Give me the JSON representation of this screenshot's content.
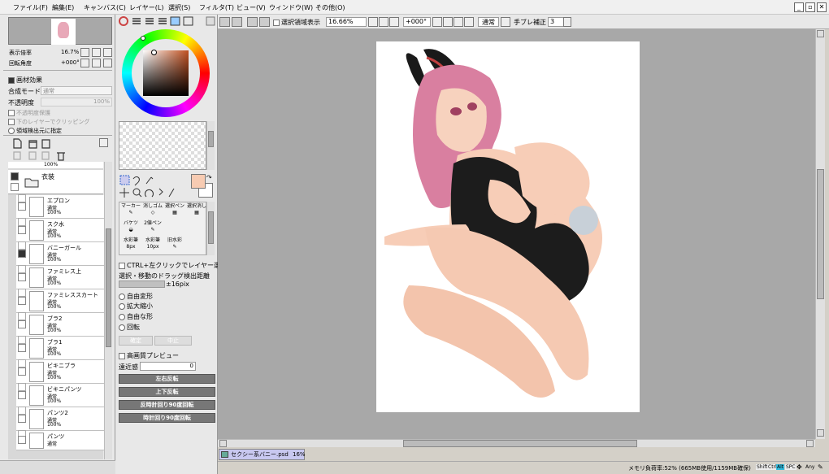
{
  "menu": [
    "ファイル(F)",
    "編集(E)",
    "キャンバス(C)",
    "レイヤー(L)",
    "選択(S)",
    "フィルタ(T)",
    "ビュー(V)",
    "ウィンドウ(W)",
    "その他(O)"
  ],
  "navigator": {
    "zoom_label": "表示倍率",
    "zoom_value": "16.7%",
    "rotate_label": "回転角度",
    "rotate_value": "+000°"
  },
  "material": {
    "title": "画材効果",
    "blend_label": "合成モード",
    "blend_value": "通常",
    "opacity_label": "不透明度",
    "opacity_value": "100%",
    "protect_opacity": "不透明度保護",
    "clip": "下のレイヤーでクリッピング",
    "detect": "領域検出元に指定"
  },
  "layers": [
    {
      "name": "衣装",
      "mode": "",
      "opacity": "",
      "folder": true
    },
    {
      "name": "エプロン",
      "mode": "通常",
      "opacity": "100%"
    },
    {
      "name": "スク水",
      "mode": "通常",
      "opacity": "100%"
    },
    {
      "name": "バニーガール",
      "mode": "通常",
      "opacity": "100%"
    },
    {
      "name": "ファミレス上",
      "mode": "通常",
      "opacity": "100%"
    },
    {
      "name": "ファミレススカート",
      "mode": "通常",
      "opacity": "100%"
    },
    {
      "name": "ブラ2",
      "mode": "通常",
      "opacity": "100%"
    },
    {
      "name": "ブラ1",
      "mode": "通常",
      "opacity": "100%"
    },
    {
      "name": "ビキニブラ",
      "mode": "通常",
      "opacity": "100%"
    },
    {
      "name": "ビキニパンツ",
      "mode": "通常",
      "opacity": "100%"
    },
    {
      "name": "パンツ2",
      "mode": "通常",
      "opacity": "100%"
    },
    {
      "name": "パンツ",
      "mode": "通常",
      "opacity": ""
    }
  ],
  "layer_top_opacity": "100%",
  "brushes": [
    {
      "name": "マーカー"
    },
    {
      "name": "消しゴム"
    },
    {
      "name": "選択ペン"
    },
    {
      "name": "選択消し"
    },
    {
      "name": "バケツ"
    },
    {
      "name": "2値ペン"
    },
    {
      "name": "水彩筆",
      "size": "8px"
    },
    {
      "name": "水彩筆",
      "size": "10px"
    },
    {
      "name": "旧水彩"
    }
  ],
  "options": {
    "ctrl_select": "CTRL+左クリックでレイヤー選択",
    "drag_label": "選択・移動のドラッグ検出距離",
    "drag_value": "±16pix",
    "transforms": [
      "自由変形",
      "拡大縮小",
      "自由な形",
      "回転"
    ],
    "ok": "確定",
    "cancel": "中止",
    "hq_preview": "高画質プレビュー",
    "distance_label": "遠近感",
    "distance_value": "0",
    "actions": [
      "左右反転",
      "上下反転",
      "反時計回り90度回転",
      "時計回り90度回転"
    ]
  },
  "toolbar": {
    "selection_display": "選択領域表示",
    "zoom": "16.66%",
    "angle": "+000°",
    "mode": "通常",
    "stabilizer_label": "手ブレ補正",
    "stabilizer_value": "3"
  },
  "canvas_tab": {
    "name": "セクシー系バニー.psd",
    "zoom": "16%"
  },
  "status": {
    "memory": "メモリ負荷率:52% (665MB使用/1159MB確保)",
    "keys": [
      "Shift",
      "Ctrl",
      "Alt",
      "SPC"
    ],
    "any": "Any"
  },
  "colors": {
    "accent": "#3a8fd0",
    "fg_swatch": "#f7cbb2",
    "canvas_bg": "#a8a8a8",
    "button_dark": "#7a7a7a"
  }
}
